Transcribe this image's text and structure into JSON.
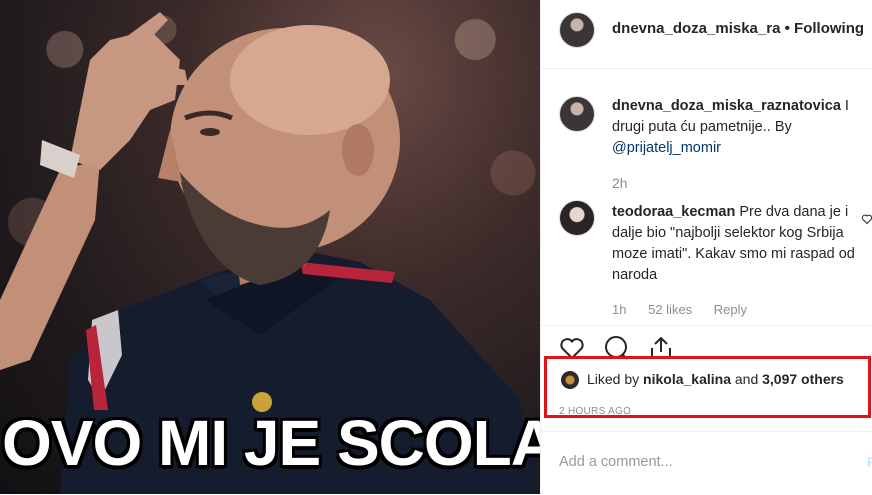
{
  "photo": {
    "caption": "OVO MI JE SCOLA"
  },
  "header": {
    "username": "dnevna_doza_miska_ra",
    "separator": "•",
    "follow_label": "Following"
  },
  "caption_comment": {
    "username": "dnevna_doza_miska_raznatovica",
    "text": " I drugi puta ću pametnije.. By ",
    "mention": "@prijatelj_momir",
    "time": "2h"
  },
  "comment": {
    "username": "teodoraa_kecman",
    "text": " Pre dva dana je i dalje bio \"najbolji selektor kog Srbija moze imati\". Kakav smo mi raspad od naroda",
    "time": "1h",
    "likes": "52 likes",
    "reply_label": "Reply"
  },
  "actions": {
    "like_icon": "heart-icon",
    "comment_icon": "comment-bubble-icon",
    "share_icon": "share-icon"
  },
  "likes": {
    "prefix": "Liked by ",
    "user": "nikola_kalina",
    "middle": " and ",
    "others": "3,097 others",
    "timestamp": "2 HOURS AGO"
  },
  "comment_box": {
    "placeholder": "Add a comment...",
    "post_label": "P"
  },
  "colors": {
    "highlight_box": "#e0131a",
    "link": "#00376b",
    "muted": "#8e8e8e"
  }
}
